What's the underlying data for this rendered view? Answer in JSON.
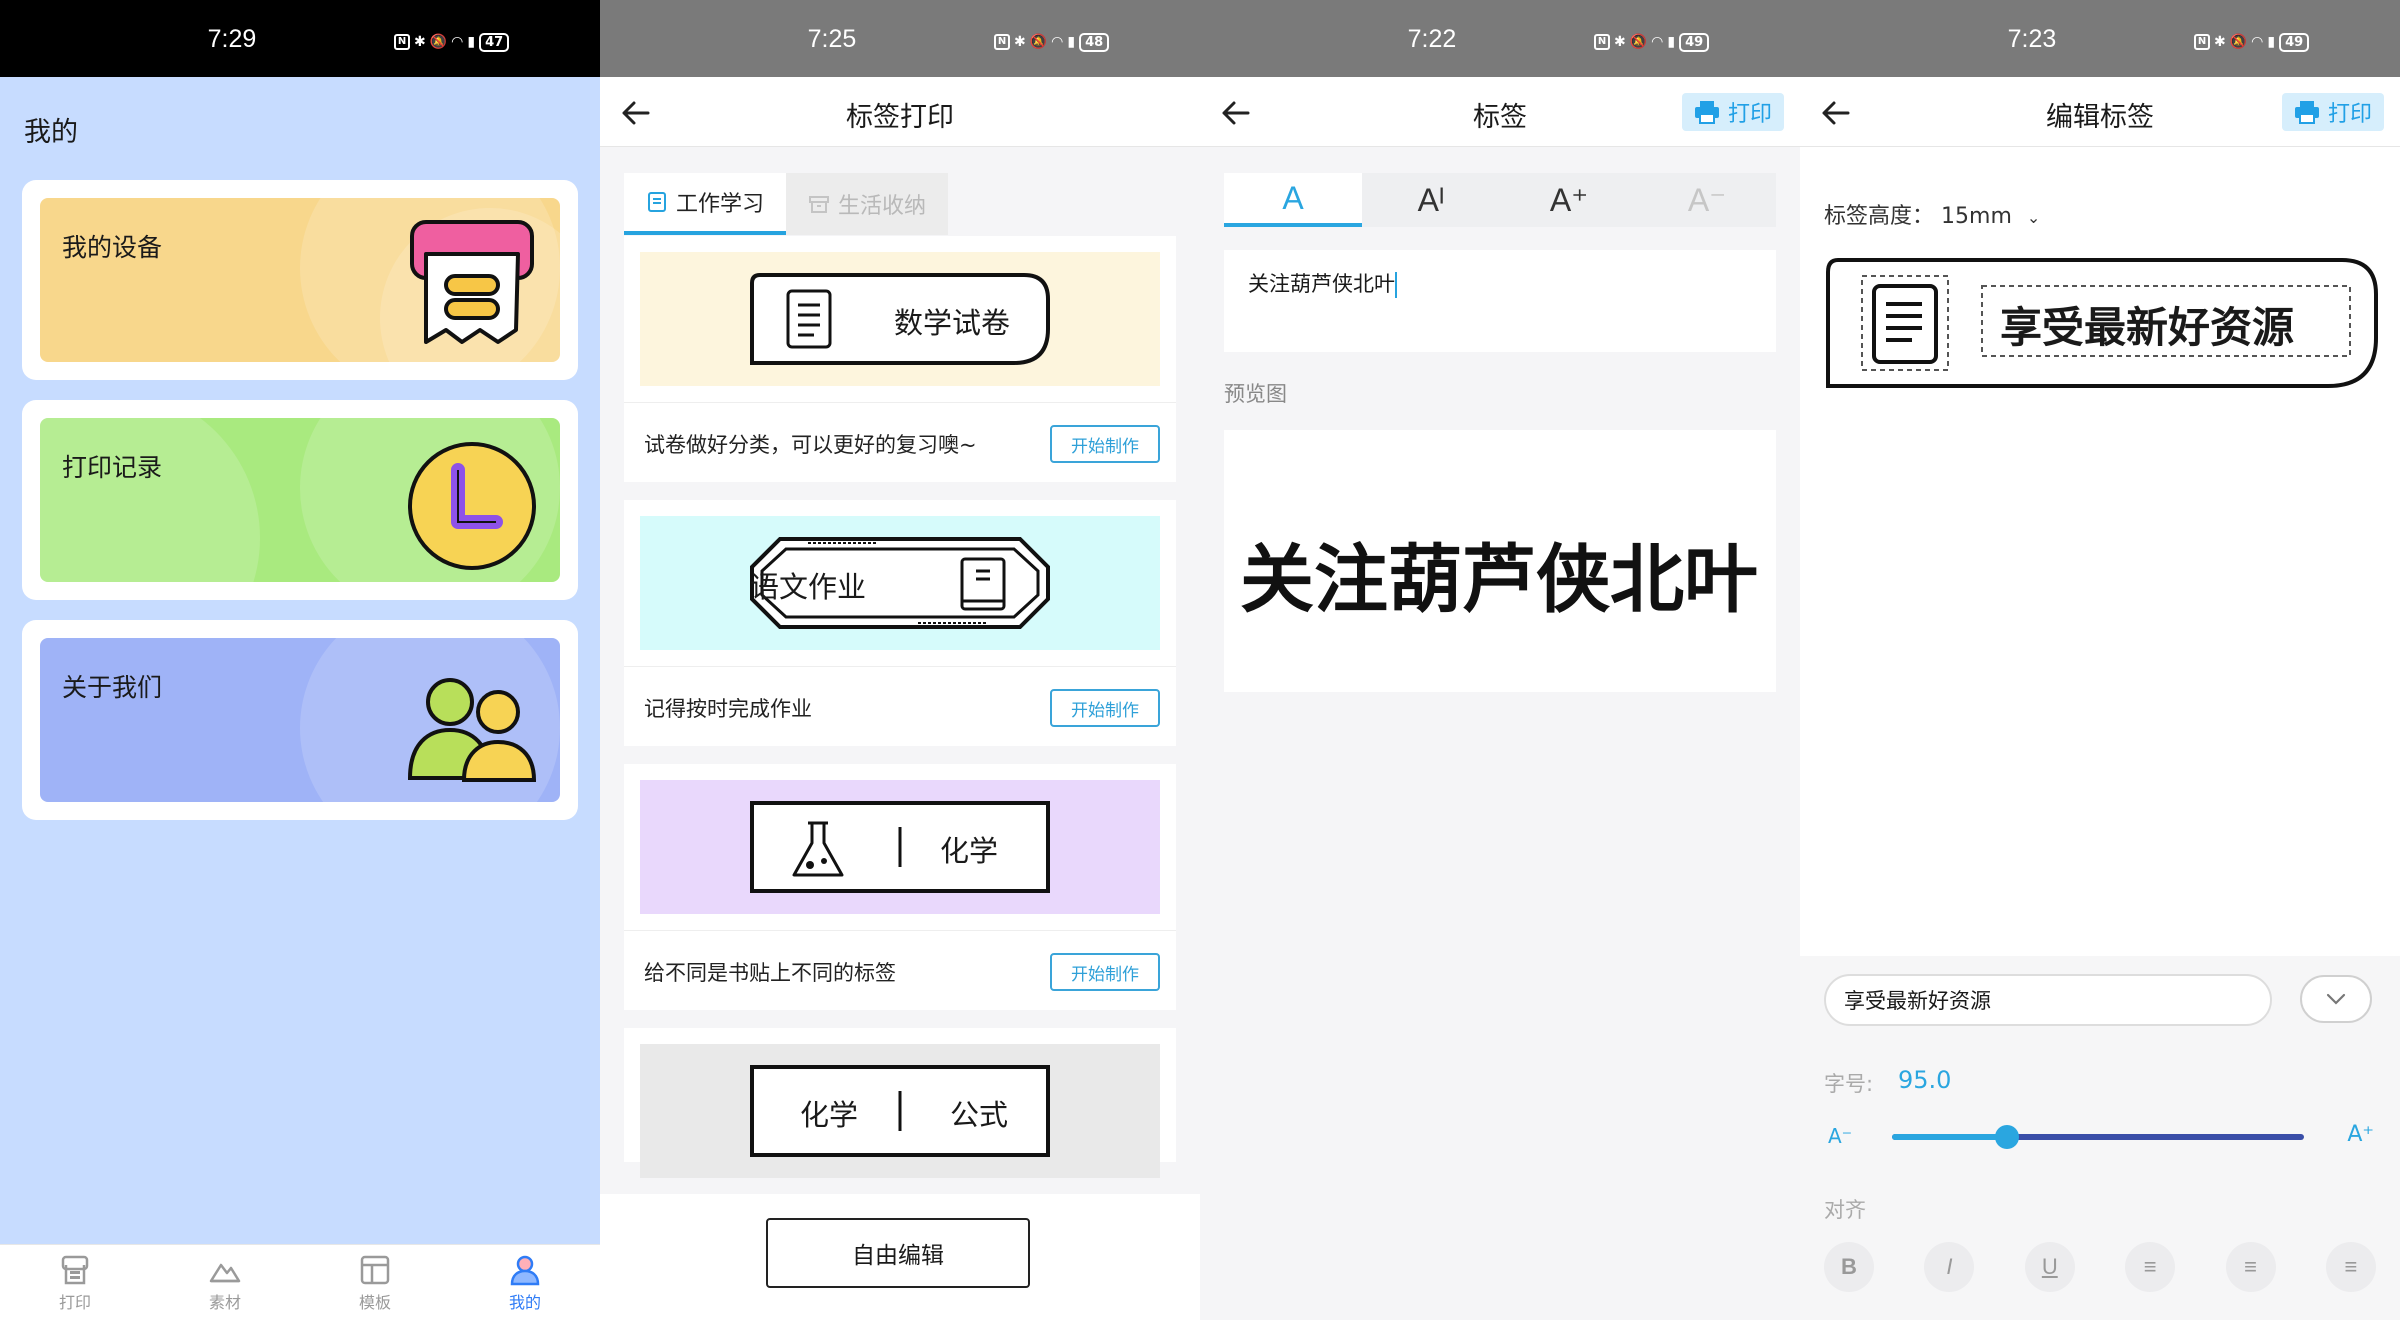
{
  "panel1": {
    "status": {
      "time": "7:29",
      "battery": "47"
    },
    "title": "我的",
    "cards": [
      {
        "label": "我的设备",
        "color": "#f8d78c"
      },
      {
        "label": "打印记录",
        "color": "#a9ea7f"
      },
      {
        "label": "关于我们",
        "color": "#9fb3f7"
      }
    ],
    "tabbar": [
      {
        "label": "打印",
        "icon": "print-icon",
        "active": false
      },
      {
        "label": "素材",
        "icon": "mountain-icon",
        "active": false
      },
      {
        "label": "模板",
        "icon": "template-icon",
        "active": false
      },
      {
        "label": "我的",
        "icon": "person-icon",
        "active": true
      }
    ]
  },
  "panel2": {
    "status": {
      "time": "7:25",
      "battery": "48"
    },
    "title": "标签打印",
    "tabs": [
      {
        "label": "工作学习",
        "active": true
      },
      {
        "label": "生活收纳",
        "active": false
      }
    ],
    "templates": [
      {
        "text": "数学试卷",
        "desc": "试卷做好分类，可以更好的复习噢~",
        "button": "开始制作",
        "bg": "#fdf5dd"
      },
      {
        "text": "语文作业",
        "desc": "记得按时完成作业",
        "button": "开始制作",
        "bg": "#d6fbfb"
      },
      {
        "text": "化学",
        "desc": "给不同是书贴上不同的标签",
        "button": "开始制作",
        "bg": "#e9d8fc"
      },
      {
        "text_left": "化学",
        "text_right": "公式",
        "bg": "#e9e9e9"
      }
    ],
    "free_edit": "自由编辑"
  },
  "panel3": {
    "status": {
      "time": "7:22",
      "battery": "49"
    },
    "title": "标签",
    "print_label": "打印",
    "format_buttons": [
      "A",
      "Aᴵ",
      "A⁺",
      "A⁻"
    ],
    "input_text": "关注葫芦侠北叶",
    "preview_label": "预览图",
    "preview_text": "关注葫芦侠北叶"
  },
  "panel4": {
    "status": {
      "time": "7:23",
      "battery": "49"
    },
    "title": "编辑标签",
    "print_label": "打印",
    "height_label": "标签高度：",
    "height_value": "15mm",
    "label_text": "享受最新好资源",
    "input_value": "享受最新好资源",
    "font_size_label": "字号:",
    "font_size_value": "95.0",
    "slider_fraction": 0.28,
    "slider_small": "A⁻",
    "slider_big": "A⁺",
    "align_label": "对齐",
    "align_buttons": [
      "B",
      "I",
      "U",
      "≡",
      "≡",
      "≡"
    ]
  }
}
